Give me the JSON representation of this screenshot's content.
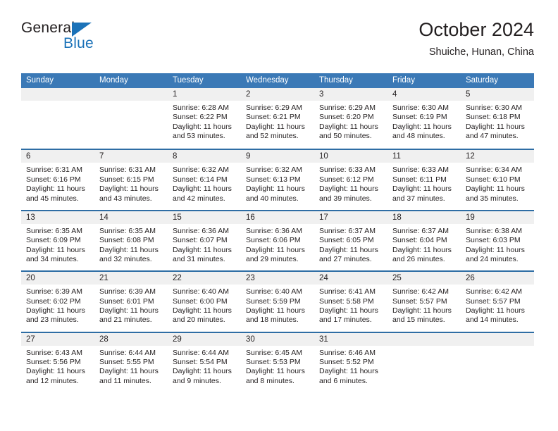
{
  "brand": {
    "name_part1": "General",
    "name_part2": "Blue",
    "triangle_color": "#1b72b8"
  },
  "header": {
    "title": "October 2024",
    "subtitle": "Shuiche, Hunan, China"
  },
  "theme": {
    "header_blue": "#3b79b6",
    "row_rule_blue": "#2e6da4",
    "date_strip_gray": "#f0f0f0",
    "text_color": "#231f20"
  },
  "calendar": {
    "day_headers": [
      "Sunday",
      "Monday",
      "Tuesday",
      "Wednesday",
      "Thursday",
      "Friday",
      "Saturday"
    ],
    "weeks": [
      [
        {
          "date": "",
          "empty": true
        },
        {
          "date": "",
          "empty": true
        },
        {
          "date": "1",
          "sunrise": "Sunrise: 6:28 AM",
          "sunset": "Sunset: 6:22 PM",
          "daylight": "Daylight: 11 hours and 53 minutes."
        },
        {
          "date": "2",
          "sunrise": "Sunrise: 6:29 AM",
          "sunset": "Sunset: 6:21 PM",
          "daylight": "Daylight: 11 hours and 52 minutes."
        },
        {
          "date": "3",
          "sunrise": "Sunrise: 6:29 AM",
          "sunset": "Sunset: 6:20 PM",
          "daylight": "Daylight: 11 hours and 50 minutes."
        },
        {
          "date": "4",
          "sunrise": "Sunrise: 6:30 AM",
          "sunset": "Sunset: 6:19 PM",
          "daylight": "Daylight: 11 hours and 48 minutes."
        },
        {
          "date": "5",
          "sunrise": "Sunrise: 6:30 AM",
          "sunset": "Sunset: 6:18 PM",
          "daylight": "Daylight: 11 hours and 47 minutes."
        }
      ],
      [
        {
          "date": "6",
          "sunrise": "Sunrise: 6:31 AM",
          "sunset": "Sunset: 6:16 PM",
          "daylight": "Daylight: 11 hours and 45 minutes."
        },
        {
          "date": "7",
          "sunrise": "Sunrise: 6:31 AM",
          "sunset": "Sunset: 6:15 PM",
          "daylight": "Daylight: 11 hours and 43 minutes."
        },
        {
          "date": "8",
          "sunrise": "Sunrise: 6:32 AM",
          "sunset": "Sunset: 6:14 PM",
          "daylight": "Daylight: 11 hours and 42 minutes."
        },
        {
          "date": "9",
          "sunrise": "Sunrise: 6:32 AM",
          "sunset": "Sunset: 6:13 PM",
          "daylight": "Daylight: 11 hours and 40 minutes."
        },
        {
          "date": "10",
          "sunrise": "Sunrise: 6:33 AM",
          "sunset": "Sunset: 6:12 PM",
          "daylight": "Daylight: 11 hours and 39 minutes."
        },
        {
          "date": "11",
          "sunrise": "Sunrise: 6:33 AM",
          "sunset": "Sunset: 6:11 PM",
          "daylight": "Daylight: 11 hours and 37 minutes."
        },
        {
          "date": "12",
          "sunrise": "Sunrise: 6:34 AM",
          "sunset": "Sunset: 6:10 PM",
          "daylight": "Daylight: 11 hours and 35 minutes."
        }
      ],
      [
        {
          "date": "13",
          "sunrise": "Sunrise: 6:35 AM",
          "sunset": "Sunset: 6:09 PM",
          "daylight": "Daylight: 11 hours and 34 minutes."
        },
        {
          "date": "14",
          "sunrise": "Sunrise: 6:35 AM",
          "sunset": "Sunset: 6:08 PM",
          "daylight": "Daylight: 11 hours and 32 minutes."
        },
        {
          "date": "15",
          "sunrise": "Sunrise: 6:36 AM",
          "sunset": "Sunset: 6:07 PM",
          "daylight": "Daylight: 11 hours and 31 minutes."
        },
        {
          "date": "16",
          "sunrise": "Sunrise: 6:36 AM",
          "sunset": "Sunset: 6:06 PM",
          "daylight": "Daylight: 11 hours and 29 minutes."
        },
        {
          "date": "17",
          "sunrise": "Sunrise: 6:37 AM",
          "sunset": "Sunset: 6:05 PM",
          "daylight": "Daylight: 11 hours and 27 minutes."
        },
        {
          "date": "18",
          "sunrise": "Sunrise: 6:37 AM",
          "sunset": "Sunset: 6:04 PM",
          "daylight": "Daylight: 11 hours and 26 minutes."
        },
        {
          "date": "19",
          "sunrise": "Sunrise: 6:38 AM",
          "sunset": "Sunset: 6:03 PM",
          "daylight": "Daylight: 11 hours and 24 minutes."
        }
      ],
      [
        {
          "date": "20",
          "sunrise": "Sunrise: 6:39 AM",
          "sunset": "Sunset: 6:02 PM",
          "daylight": "Daylight: 11 hours and 23 minutes."
        },
        {
          "date": "21",
          "sunrise": "Sunrise: 6:39 AM",
          "sunset": "Sunset: 6:01 PM",
          "daylight": "Daylight: 11 hours and 21 minutes."
        },
        {
          "date": "22",
          "sunrise": "Sunrise: 6:40 AM",
          "sunset": "Sunset: 6:00 PM",
          "daylight": "Daylight: 11 hours and 20 minutes."
        },
        {
          "date": "23",
          "sunrise": "Sunrise: 6:40 AM",
          "sunset": "Sunset: 5:59 PM",
          "daylight": "Daylight: 11 hours and 18 minutes."
        },
        {
          "date": "24",
          "sunrise": "Sunrise: 6:41 AM",
          "sunset": "Sunset: 5:58 PM",
          "daylight": "Daylight: 11 hours and 17 minutes."
        },
        {
          "date": "25",
          "sunrise": "Sunrise: 6:42 AM",
          "sunset": "Sunset: 5:57 PM",
          "daylight": "Daylight: 11 hours and 15 minutes."
        },
        {
          "date": "26",
          "sunrise": "Sunrise: 6:42 AM",
          "sunset": "Sunset: 5:57 PM",
          "daylight": "Daylight: 11 hours and 14 minutes."
        }
      ],
      [
        {
          "date": "27",
          "sunrise": "Sunrise: 6:43 AM",
          "sunset": "Sunset: 5:56 PM",
          "daylight": "Daylight: 11 hours and 12 minutes."
        },
        {
          "date": "28",
          "sunrise": "Sunrise: 6:44 AM",
          "sunset": "Sunset: 5:55 PM",
          "daylight": "Daylight: 11 hours and 11 minutes."
        },
        {
          "date": "29",
          "sunrise": "Sunrise: 6:44 AM",
          "sunset": "Sunset: 5:54 PM",
          "daylight": "Daylight: 11 hours and 9 minutes."
        },
        {
          "date": "30",
          "sunrise": "Sunrise: 6:45 AM",
          "sunset": "Sunset: 5:53 PM",
          "daylight": "Daylight: 11 hours and 8 minutes."
        },
        {
          "date": "31",
          "sunrise": "Sunrise: 6:46 AM",
          "sunset": "Sunset: 5:52 PM",
          "daylight": "Daylight: 11 hours and 6 minutes."
        },
        {
          "date": "",
          "empty": true
        },
        {
          "date": "",
          "empty": true
        }
      ]
    ]
  }
}
